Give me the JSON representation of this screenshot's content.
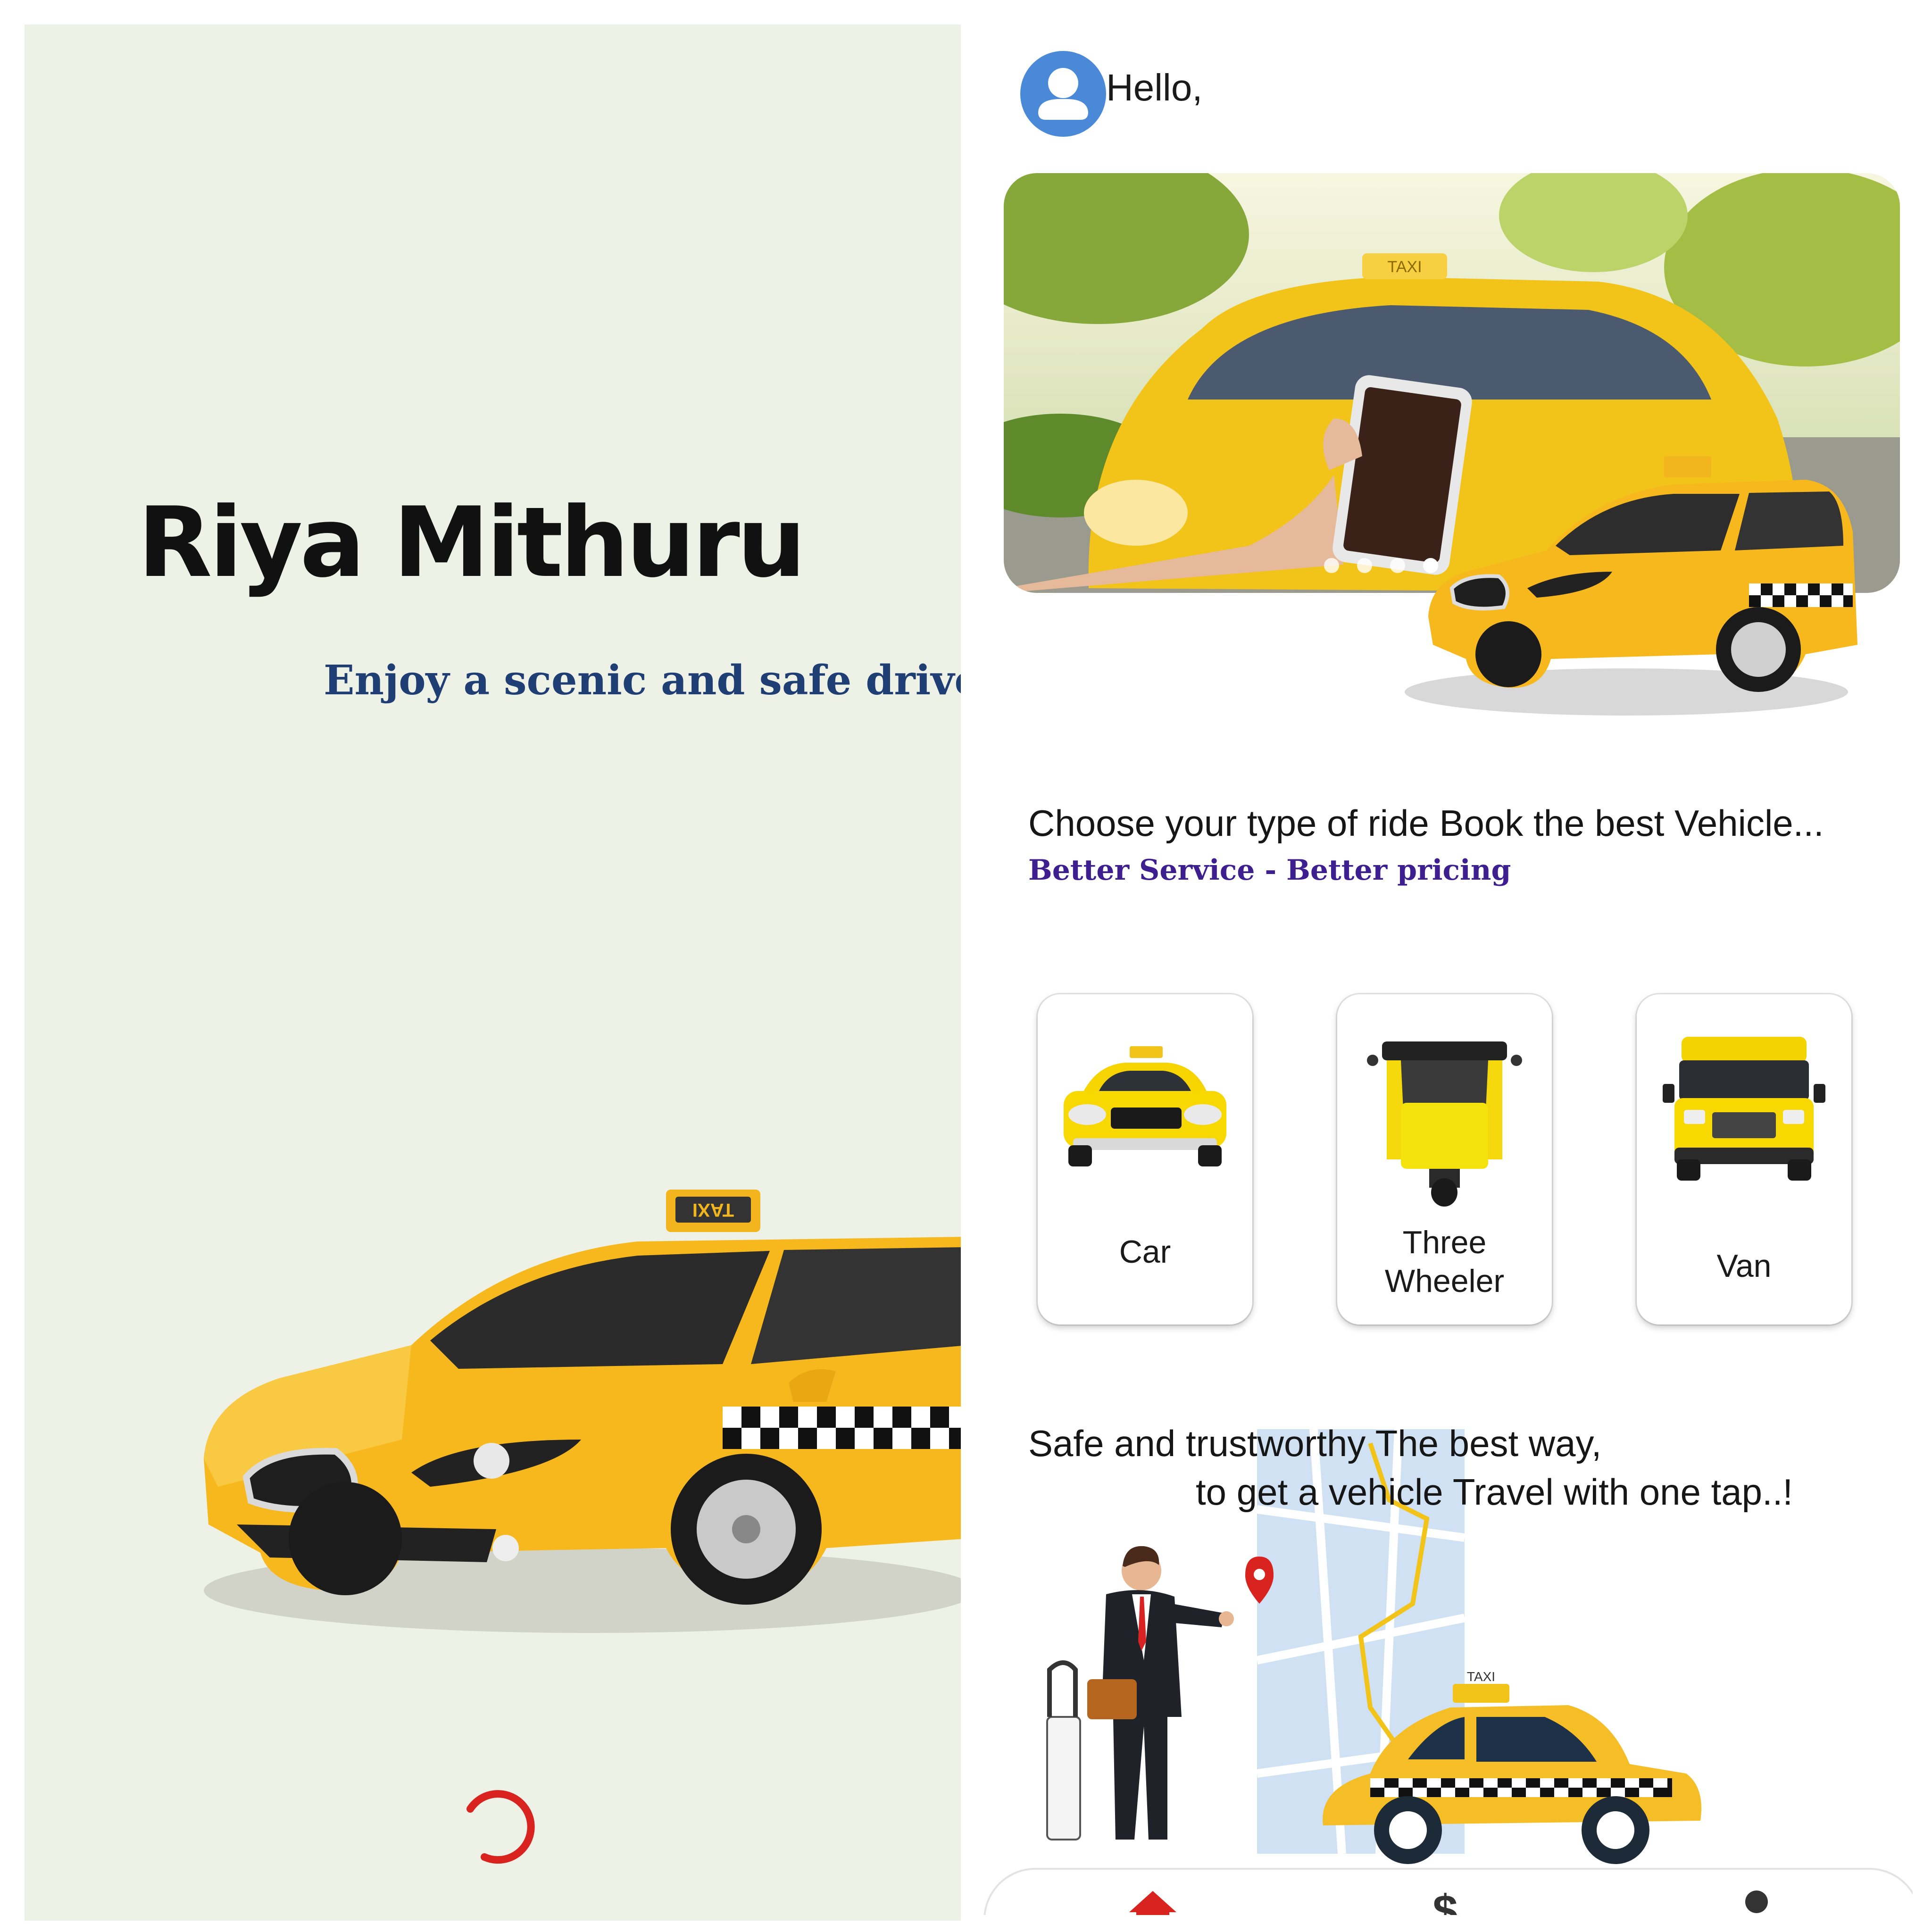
{
  "splash": {
    "app_name": "Riya Mithuru",
    "tagline": "Enjoy a scenic and safe drive",
    "taxi_sign": "TAXI"
  },
  "home": {
    "greeting": "Hello,",
    "banner": {
      "taxi_sign": "TAXI",
      "slide_count": 4,
      "active_slide": 4
    },
    "section1": {
      "title": "Choose your type of ride Book the best Vehicle...",
      "subtitle": "Better Service - Better pricing"
    },
    "ride_types": [
      {
        "label": "Car",
        "icon": "car-icon"
      },
      {
        "label": "Three Wheeler",
        "icon": "three-wheeler-icon"
      },
      {
        "label": "Van",
        "icon": "van-icon"
      }
    ],
    "section2": {
      "line1": "Safe and trustworthy The best way,",
      "line2": "to get a vehicle Travel with one tap..!"
    },
    "illustration": {
      "taxi_sign": "TAXI"
    },
    "nav": {
      "items": [
        {
          "name": "home",
          "icon": "home-icon",
          "active": true
        },
        {
          "name": "payments",
          "icon": "dollar-icon",
          "active": false
        },
        {
          "name": "profile",
          "icon": "person-icon",
          "active": false
        }
      ]
    }
  },
  "colors": {
    "splash_bg": "#eef1e6",
    "tagline": "#1f3e74",
    "subtitle": "#3d1f8f",
    "taxi_yellow": "#f6b81c",
    "avatar_blue": "#4a89d8",
    "loader_red": "#d9231f",
    "nav_active": "#d9231f"
  }
}
